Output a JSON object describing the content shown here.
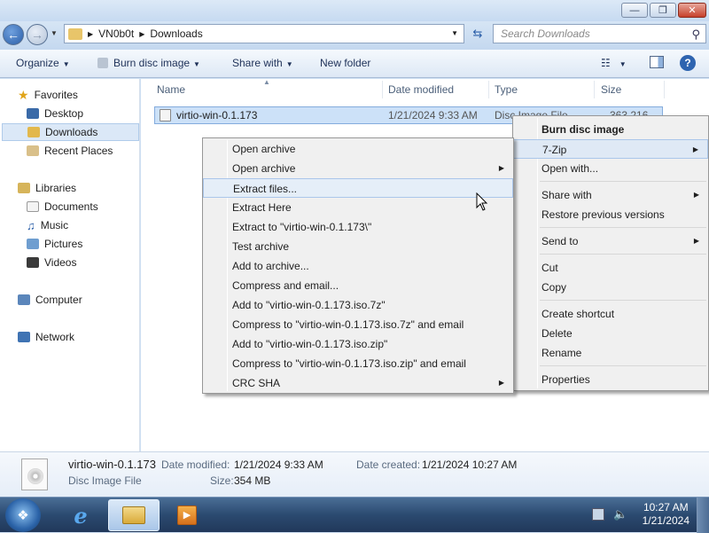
{
  "window": {
    "controls": {
      "minimize": "—",
      "maximize": "❐",
      "close": "✕"
    }
  },
  "address": {
    "segments": [
      "VN0b0t",
      "Downloads"
    ],
    "search_placeholder": "Search Downloads"
  },
  "toolbar": {
    "organize": "Organize",
    "burn": "Burn disc image",
    "share": "Share with",
    "new_folder": "New folder"
  },
  "nav": {
    "favorites": "Favorites",
    "desktop": "Desktop",
    "downloads": "Downloads",
    "recent": "Recent Places",
    "libraries": "Libraries",
    "documents": "Documents",
    "music": "Music",
    "pictures": "Pictures",
    "videos": "Videos",
    "computer": "Computer",
    "network": "Network"
  },
  "columns": {
    "name": "Name",
    "date": "Date modified",
    "type": "Type",
    "size": "Size"
  },
  "file": {
    "name": "virtio-win-0.1.173",
    "date": "1/21/2024 9:33 AM",
    "type": "Disc Image File",
    "size": "363,216 KB"
  },
  "submenu_7zip": [
    "Open archive",
    "Open archive",
    "Extract files...",
    "Extract Here",
    "Extract to \"virtio-win-0.1.173\\\"",
    "Test archive",
    "Add to archive...",
    "Compress and email...",
    "Add to \"virtio-win-0.1.173.iso.7z\"",
    "Compress to \"virtio-win-0.1.173.iso.7z\" and email",
    "Add to \"virtio-win-0.1.173.iso.zip\"",
    "Compress to \"virtio-win-0.1.173.iso.zip\" and email",
    "CRC SHA"
  ],
  "context_menu": {
    "burn": "Burn disc image",
    "sevenzip": "7-Zip",
    "open_with": "Open with...",
    "share_with": "Share with",
    "restore": "Restore previous versions",
    "send_to": "Send to",
    "cut": "Cut",
    "copy": "Copy",
    "create_shortcut": "Create shortcut",
    "delete": "Delete",
    "rename": "Rename",
    "properties": "Properties"
  },
  "details": {
    "name": "virtio-win-0.1.173",
    "date_modified_label": "Date modified:",
    "date_modified": "1/21/2024 9:33 AM",
    "date_created_label": "Date created:",
    "date_created": "1/21/2024 10:27 AM",
    "type": "Disc Image File",
    "size_label": "Size:",
    "size": "354 MB"
  },
  "taskbar": {
    "time": "10:27 AM",
    "date": "1/21/2024"
  }
}
